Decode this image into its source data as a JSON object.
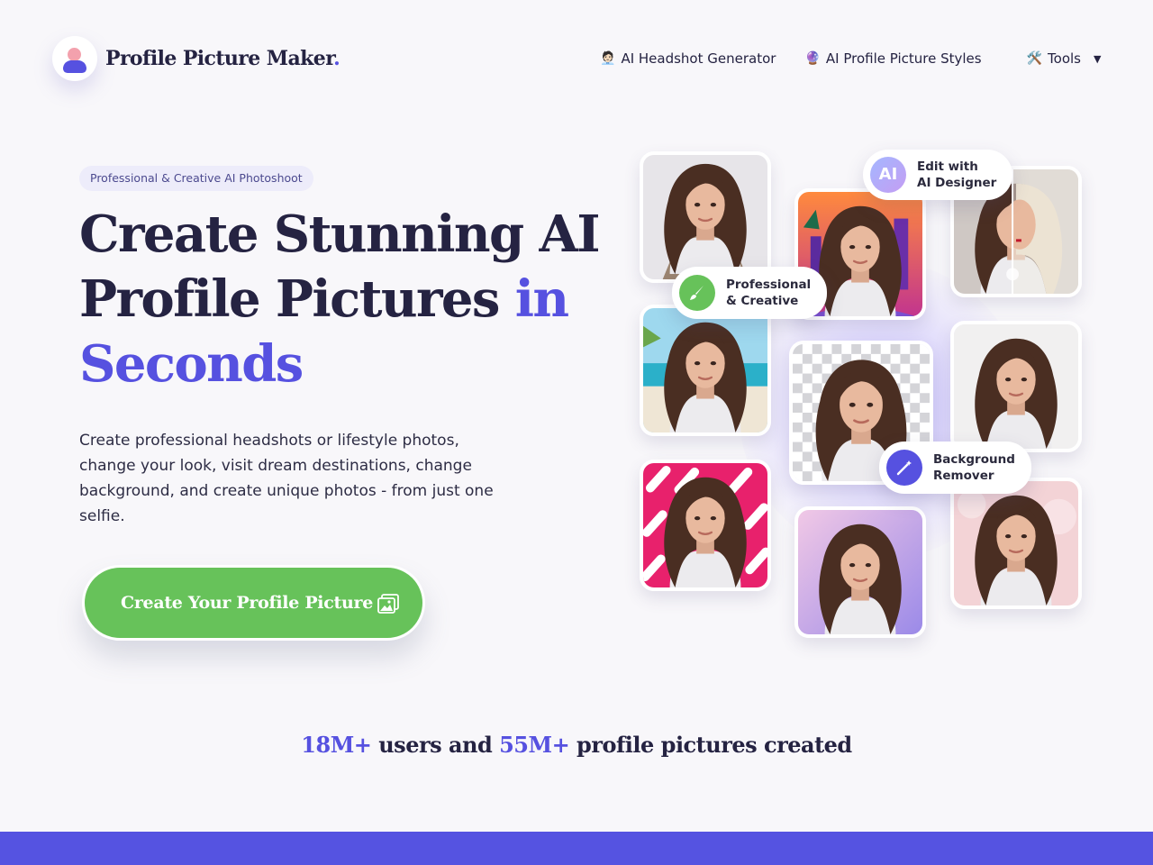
{
  "header": {
    "brand": "Profile Picture Maker",
    "brand_dot": ".",
    "nav": [
      {
        "icon": "🧑🏻‍💼",
        "label": "AI Headshot Generator"
      },
      {
        "icon": "🔮",
        "label": "AI Profile Picture Styles"
      },
      {
        "icon": "🛠️",
        "label": "Tools",
        "caret": "▼"
      }
    ]
  },
  "hero": {
    "pill": "Professional & Creative AI Photoshoot",
    "title_line1": "Create Stunning AI",
    "title_line2": "Profile Pictures ",
    "title_accent1": "in",
    "title_accent2": "Seconds",
    "description": "Create professional headshots or lifestyle photos, change your look, visit dream destinations, change background, and create unique photos - from just one selfie.",
    "cta_label": "Create Your Profile Picture"
  },
  "collage": {
    "tags": {
      "ai_designer_badge": "AI",
      "ai_designer_line1": "Edit with",
      "ai_designer_line2": "AI Designer",
      "professional_line1": "Professional",
      "professional_line2": "& Creative",
      "remover_line1": "Background",
      "remover_line2": "Remover"
    },
    "icons": [
      "paintbrush-icon",
      "magic-wand-icon",
      "image-icon"
    ]
  },
  "stats": {
    "users": "18M+",
    "users_text": " users and ",
    "pictures": "55M+",
    "pictures_text": " profile pictures created"
  },
  "colors": {
    "accent": "#5651e0",
    "cta_green": "#67c25a",
    "text_dark": "#252342",
    "background": "#f8f7fa"
  }
}
